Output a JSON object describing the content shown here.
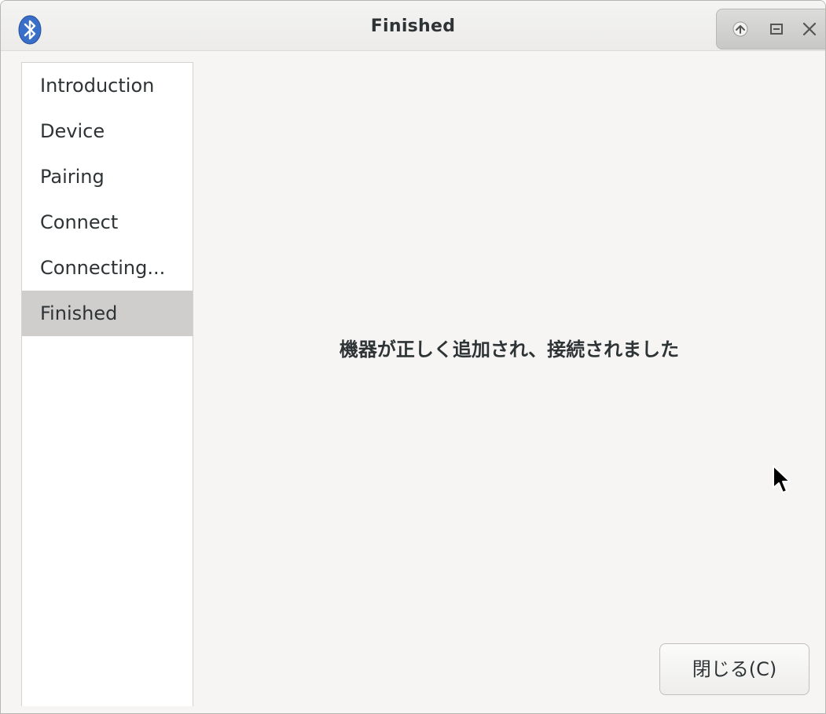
{
  "window": {
    "title": "Finished"
  },
  "sidebar": {
    "items": [
      {
        "label": "Introduction",
        "active": false
      },
      {
        "label": "Device",
        "active": false
      },
      {
        "label": "Pairing",
        "active": false
      },
      {
        "label": "Connect",
        "active": false
      },
      {
        "label": "Connecting...",
        "active": false
      },
      {
        "label": "Finished",
        "active": true
      }
    ]
  },
  "main": {
    "message": "機器が正しく追加され、接続されました"
  },
  "footer": {
    "close_label": "閉じる(C)"
  },
  "icons": {
    "app": "bluetooth-icon",
    "window_controls": [
      "shade-icon",
      "maximize-icon",
      "close-icon"
    ]
  },
  "colors": {
    "bluetooth_blue": "#3a6fc9",
    "active_item_bg": "#cfcecc",
    "window_bg": "#f6f5f4"
  }
}
